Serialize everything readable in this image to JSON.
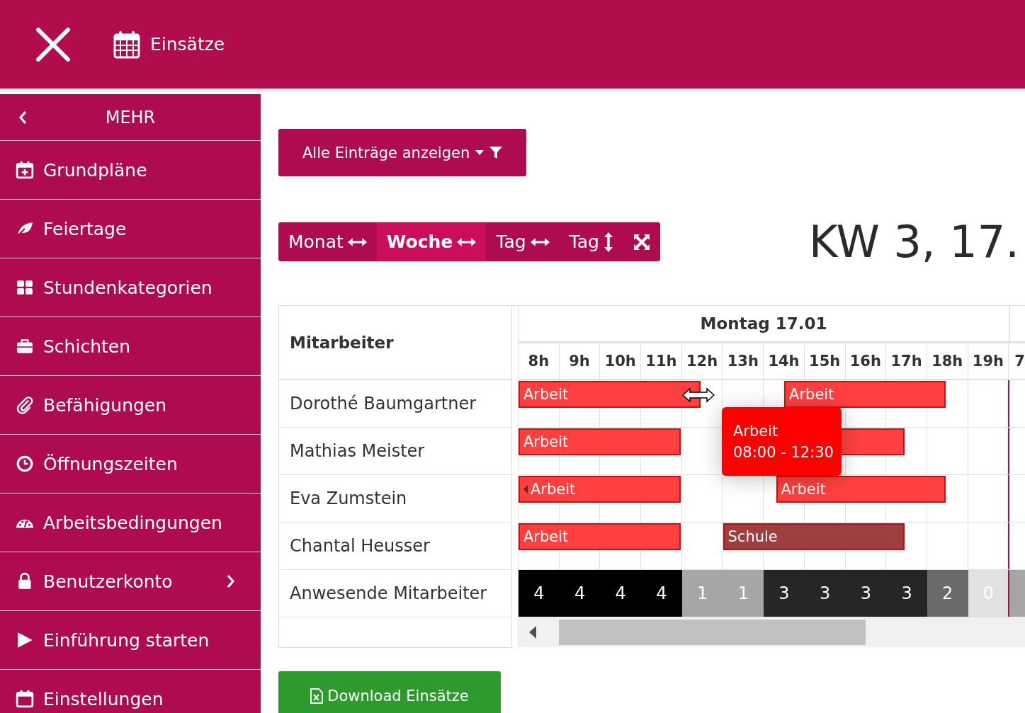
{
  "header": {
    "title": "Einsätze"
  },
  "sidebar": {
    "title": "MEHR",
    "items": [
      {
        "label": "Grundpläne",
        "submenu": false
      },
      {
        "label": "Feiertage",
        "submenu": false
      },
      {
        "label": "Stundenkategorien",
        "submenu": false
      },
      {
        "label": "Schichten",
        "submenu": false
      },
      {
        "label": "Befähigungen",
        "submenu": false
      },
      {
        "label": "Öffnungszeiten",
        "submenu": false
      },
      {
        "label": "Arbeitsbedingungen",
        "submenu": false
      },
      {
        "label": "Benutzerkonto",
        "submenu": true
      },
      {
        "label": "Einführung starten",
        "submenu": false
      },
      {
        "label": "Einstellungen",
        "submenu": false
      }
    ]
  },
  "filter_button": {
    "label": "Alle Einträge anzeigen"
  },
  "views": [
    {
      "label": "Monat",
      "selected": false,
      "kind": "horizontal"
    },
    {
      "label": "Woche",
      "selected": true,
      "kind": "horizontal"
    },
    {
      "label": "Tag",
      "selected": false,
      "kind": "horizontal"
    },
    {
      "label": "Tag",
      "selected": false,
      "kind": "vertical"
    }
  ],
  "heading": "KW 3, 17.",
  "table": {
    "column_header": "Mitarbeiter",
    "day": "Montag 17.01",
    "hours": [
      "8h",
      "9h",
      "10h",
      "11h",
      "12h",
      "13h",
      "14h",
      "15h",
      "16h",
      "17h",
      "18h",
      "19h",
      "7"
    ],
    "rows": [
      {
        "name": "Dorothé Baumgartner",
        "events": [
          {
            "label": "Arbeit",
            "color": "#ff4040",
            "continued": false
          },
          {
            "label": "Arbeit",
            "color": "#ff4040",
            "continued": false
          }
        ]
      },
      {
        "name": "Mathias Meister",
        "events": [
          {
            "label": "Arbeit",
            "color": "#ff4040",
            "continued": false
          },
          {
            "color": "#ff4040"
          }
        ]
      },
      {
        "name": "Eva Zumstein",
        "events": [
          {
            "label": "Arbeit",
            "color": "#ff4040",
            "continued": true
          },
          {
            "label": "Arbeit",
            "color": "#ff4040",
            "continued": false
          }
        ]
      },
      {
        "name": "Chantal Heusser",
        "events": [
          {
            "label": "Arbeit",
            "color": "#ff4040",
            "continued": false
          },
          {
            "label": "Schule",
            "color": "#9e3e3e",
            "continued": false
          }
        ]
      }
    ],
    "present_label": "Anwesende Mitarbeiter",
    "present": [
      {
        "value": "4",
        "color": "#000000"
      },
      {
        "value": "4",
        "color": "#000000"
      },
      {
        "value": "4",
        "color": "#000000"
      },
      {
        "value": "4",
        "color": "#000000"
      },
      {
        "value": "1",
        "color": "#a6a6a6"
      },
      {
        "value": "1",
        "color": "#a6a6a6"
      },
      {
        "value": "3",
        "color": "#262626"
      },
      {
        "value": "3",
        "color": "#262626"
      },
      {
        "value": "3",
        "color": "#262626"
      },
      {
        "value": "3",
        "color": "#262626"
      },
      {
        "value": "2",
        "color": "#6a6a6a"
      },
      {
        "value": "0",
        "color": "#e2e2e2"
      },
      {
        "color": "#a6a6a6"
      }
    ]
  },
  "tooltip": {
    "title": "Arbeit",
    "time": "08:00 - 12:30"
  },
  "download_button": {
    "label": "Download Einsätze"
  }
}
